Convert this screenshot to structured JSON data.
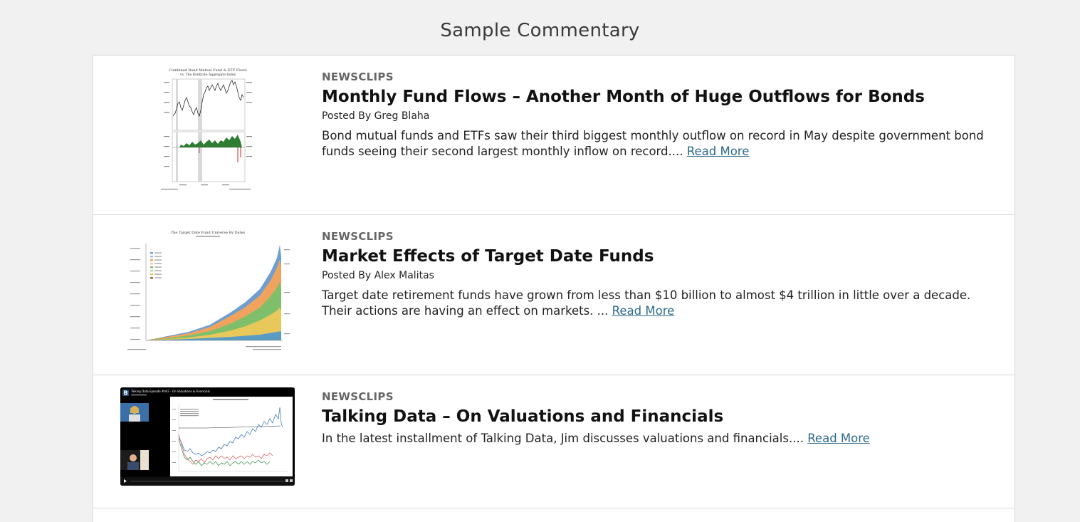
{
  "page": {
    "title": "Sample Commentary"
  },
  "posts": [
    {
      "category": "NEWSCLIPS",
      "title": "Monthly Fund Flows – Another Month of Huge Outflows for Bonds",
      "author": "Posted By Greg Blaha",
      "excerpt": "Bond mutual funds and ETFs saw their third biggest monthly outflow on record in May despite government bond funds seeing their second largest monthly inflow on record.... ",
      "read_more": "Read More",
      "thumbnail": {
        "title": "Combined Bond Mutual Fund & ETF Flows",
        "subtitle": "vs. The Bankrate Aggregate Index"
      }
    },
    {
      "category": "NEWSCLIPS",
      "title": "Market Effects of Target Date Funds",
      "author": "Posted By Alex Malitas",
      "excerpt": "Target date retirement funds have grown from less than $10 billion to almost $4 trillion in little over a decade. Their actions are having an effect on markets. ... ",
      "read_more": "Read More",
      "thumbnail": {
        "title": "The Target Date Fund Universe By Dates"
      }
    },
    {
      "category": "NEWSCLIPS",
      "title": "Talking Data – On Valuations and Financials",
      "author": "",
      "excerpt": "In the latest installment of Talking Data, Jim discusses valuations and financials.... ",
      "read_more": "Read More",
      "thumbnail": {
        "video_title": "Talking Data Episode #047 - On Valuations & Financials",
        "logo": "B"
      }
    }
  ],
  "colors": {
    "link": "#2d6a8c",
    "bond_flow_green": "#2e7d32",
    "outflow_red": "#c62828",
    "area_blue": "#6e9fd0",
    "area_orange": "#f0a35e",
    "area_green": "#7fbf6a",
    "area_yellow": "#e8c85a"
  }
}
